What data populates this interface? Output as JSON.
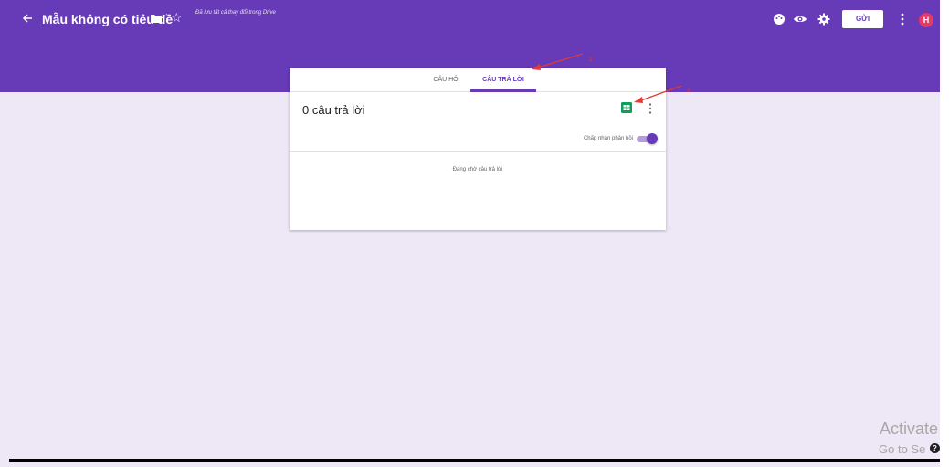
{
  "header": {
    "title": "Mẫu không có tiêu đề",
    "save_status": "Đã lưu tất cả thay đổi trong Drive",
    "send_label": "GỬI",
    "avatar_initial": "H"
  },
  "tabs": [
    {
      "label": "CÂU HỎI"
    },
    {
      "label": "CÂU TRẢ LỜI"
    }
  ],
  "responses": {
    "count_title": "0 câu trả lời",
    "accept_label": "Chấp nhận phản hồi",
    "accepting": true,
    "waiting_text": "Đang chờ câu trả lời"
  },
  "annotations": [
    {
      "label": "1"
    },
    {
      "label": "2"
    }
  ],
  "watermark": {
    "line1": "Activate",
    "line2": "Go to Se"
  },
  "colors": {
    "header": "#673ab7",
    "background": "#ede7f6",
    "accent": "#673ab7",
    "sheets_green": "#0f9d58",
    "avatar": "#e53966",
    "annotation_arrow": "#e53935"
  }
}
